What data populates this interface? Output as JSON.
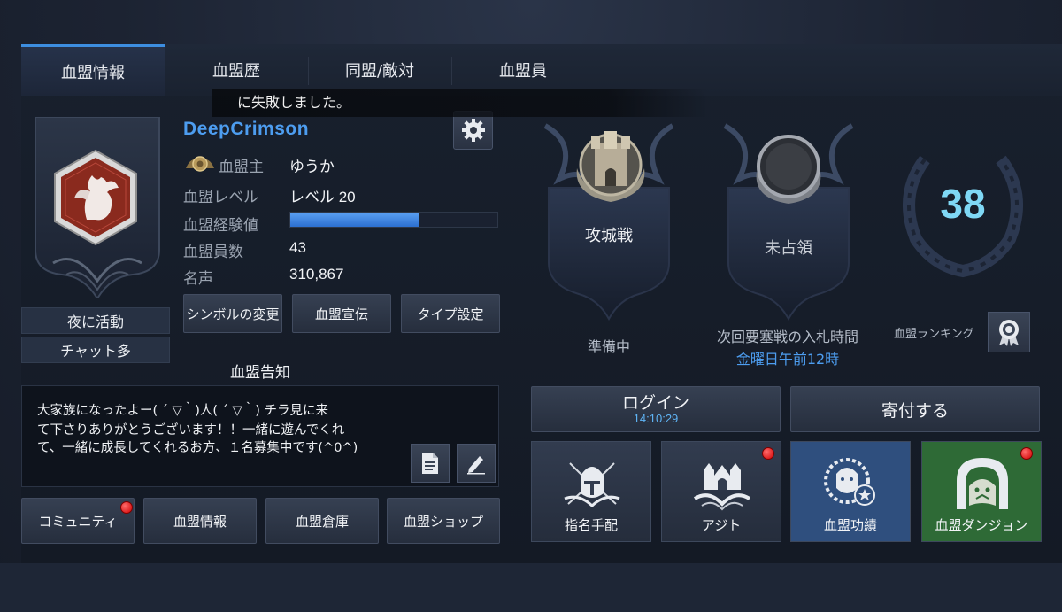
{
  "tabs": [
    "血盟情報",
    "血盟歴",
    "同盟/敵対",
    "血盟員"
  ],
  "toast": "に失敗しました。",
  "clan": {
    "name": "DeepCrimson",
    "tags": [
      "夜に活動",
      "チャット多"
    ],
    "labels": {
      "leader": "血盟主",
      "level": "血盟レベル",
      "xp": "血盟経験値",
      "members": "血盟員数",
      "fame": "名声"
    },
    "values": {
      "leader": "ゆうか",
      "level": "レベル 20",
      "xp_progress": 0.62,
      "members": "43",
      "fame": "310,867"
    }
  },
  "buttons": {
    "symbol": "シンボルの変更",
    "promote": "血盟宣伝",
    "type": "タイプ設定"
  },
  "notice": {
    "title": "血盟告知",
    "lines": [
      "大家族になったよー( ´ ▽｀)人( ´ ▽｀) チラ見に来",
      "て下さりありがとうございます！！一緒に遊んでくれ",
      "て、一緒に成長してくれるお方、１名募集中です(^0^)"
    ]
  },
  "bottom_buttons": [
    "コミュニティ",
    "血盟情報",
    "血盟倉庫",
    "血盟ショップ"
  ],
  "war": {
    "siege_label": "攻城戦",
    "siege_status": "準備中",
    "territory_label": "未占領",
    "bid_label": "次回要塞戦の入札時間",
    "bid_time": "金曜日午前12時",
    "ranking": "38",
    "ranking_label": "血盟ランキング"
  },
  "actions": {
    "login": "ログイン",
    "login_time": "14:10:29",
    "donate": "寄付する"
  },
  "tiles": [
    "指名手配",
    "アジト",
    "血盟功績",
    "血盟ダンジョン"
  ],
  "colors": {
    "accent": "#3d8ee0",
    "clan_name": "#4d9df0",
    "ranking": "#7fd8f5",
    "highlight_tile": "#2f4f7e",
    "dungeon_tile": "#2e6a36",
    "notification": "#e00000"
  }
}
